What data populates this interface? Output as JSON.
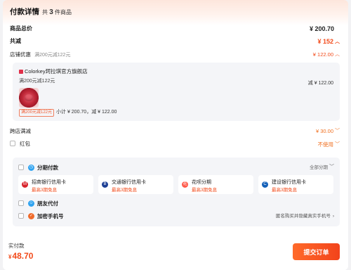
{
  "header": {
    "title": "付款详情",
    "count_prefix": "共",
    "count": "3",
    "count_suffix": "件商品"
  },
  "summary": {
    "total_label": "商品总价",
    "total_value": "¥ 200.70",
    "reduction_label": "共减",
    "reduction_value": "¥ 152",
    "store_promo_label": "店铺优惠",
    "store_promo_desc": "满200元减122元",
    "store_promo_value": "¥ 122.00"
  },
  "store": {
    "name": "Colorkey珂拉琪官方旗舰店",
    "promo": "满200元减122元",
    "minus": "减 ¥ 122.00",
    "tag": "满200元减122元",
    "subtotal": "小计 ¥ 200.70，减 ¥ 122.00"
  },
  "cross_store": {
    "label": "跨店满减",
    "value": "¥ 30.00"
  },
  "red_packet": {
    "label": "红包",
    "value": "不使用"
  },
  "payment": {
    "installment_label": "分期付款",
    "all_installments": "全部分期",
    "cards": [
      {
        "name": "招商银行信用卡",
        "promo": "最高3期免息",
        "icon": "cmb-bank-icon",
        "color": "#d8242c"
      },
      {
        "name": "交通银行信用卡",
        "promo": "最高3期免息",
        "icon": "bocom-bank-icon",
        "color": "#1c3f94"
      },
      {
        "name": "花呗分期",
        "promo": "最高3期免息",
        "icon": "huabei-icon",
        "color": "#ff5a4a"
      },
      {
        "name": "建设银行信用卡",
        "promo": "最高3期免息",
        "icon": "ccb-bank-icon",
        "color": "#1360b8"
      }
    ],
    "friend_pay_label": "朋友代付",
    "encrypted_phone_label": "加密手机号",
    "encrypted_phone_desc": "匿名购买并隐藏真实手机号"
  },
  "footer": {
    "pay_label": "实付款",
    "currency": "¥",
    "pay_amount": "48.70",
    "submit_label": "提交订单"
  },
  "colors": {
    "accent": "#f24b1b",
    "orange": "#f07020",
    "panel_gray": "#f4f5f8"
  }
}
